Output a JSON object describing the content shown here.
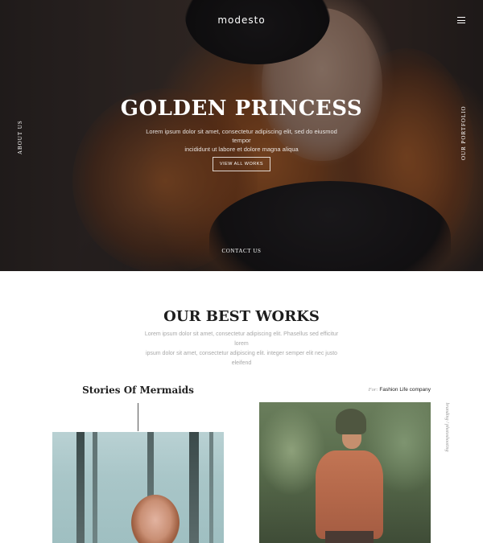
{
  "hero": {
    "brand": "modesto",
    "title": "GOLDEN PRINCESS",
    "subtitle_line1": "Lorem ipsum dolor sit amet, consectetur adipiscing elit, sed do eiusmod tempor",
    "subtitle_line2": "incididunt ut labore et dolore magna aliqua",
    "button_label": "VIEW ALL WORKS",
    "side_left": "ABOUT US",
    "side_right": "OUR PORTFOLIO",
    "contact": "CONTACT US",
    "menu_icon": "hamburger-icon"
  },
  "works": {
    "title": "OUR BEST WORKS",
    "subtitle_line1": "Lorem ipsum dolor sit amet, consectetur adipiscing elit. Phasellus sed efficitur lorem",
    "subtitle_line2": "ipsum dolor sit amet, consectetur adipiscing elit. integer semper elit nec justo eleifend"
  },
  "projects": [
    {
      "title": "Stories Of Mermaids"
    },
    {
      "for_prefix": "For:",
      "client": "Fashion Life company",
      "category": "branding / photoshooting"
    }
  ]
}
